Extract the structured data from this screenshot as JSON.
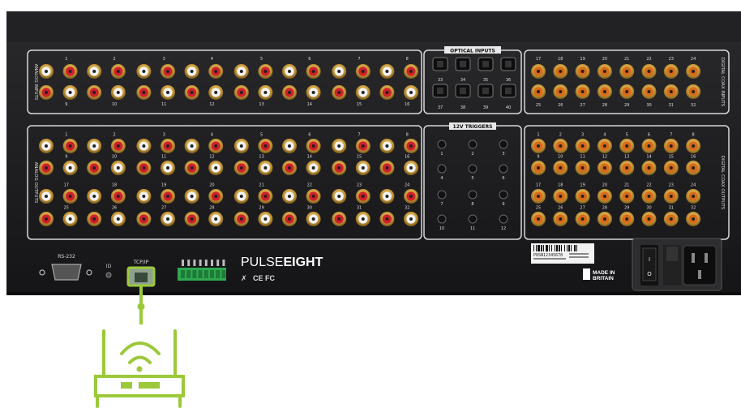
{
  "device": {
    "brand_light": "PULSE",
    "brand_bold": "EIGHT",
    "certification_marks": "CE FC",
    "made_in_line1": "MADE IN",
    "made_in_line2": "BRITAIN",
    "serial_label": "P8SN12345678"
  },
  "ports": {
    "rs232_label": "RS-232",
    "id_label": "ID",
    "tcpip_label": "TCP/IP"
  },
  "sections": {
    "analog_inputs": "ANALOG INPUTS",
    "analog_outputs": "ANALOG OUTPUTS",
    "optical_inputs": "OPTICAL INPUTS",
    "triggers": "12V TRIGGERS",
    "digital_coax_inputs": "DIGITAL COAX INPUTS",
    "digital_coax_outputs": "DIGITAL COAX OUTPUTS"
  },
  "numbers": {
    "analog_in_top": [
      "1",
      "2",
      "3",
      "4",
      "5",
      "6",
      "7",
      "8"
    ],
    "analog_in_bottom": [
      "9",
      "10",
      "11",
      "12",
      "13",
      "14",
      "15",
      "16"
    ],
    "analog_out_r1": [
      "1",
      "2",
      "3",
      "4",
      "5",
      "6",
      "7",
      "8"
    ],
    "analog_out_r2": [
      "9",
      "10",
      "11",
      "12",
      "13",
      "14",
      "15",
      "16"
    ],
    "analog_out_r3": [
      "17",
      "18",
      "19",
      "20",
      "21",
      "22",
      "23",
      "24"
    ],
    "analog_out_r4": [
      "25",
      "26",
      "27",
      "28",
      "29",
      "30",
      "31",
      "32"
    ],
    "optical_top": [
      "33",
      "34",
      "35",
      "36"
    ],
    "optical_bottom": [
      "37",
      "38",
      "39",
      "40"
    ],
    "triggers": [
      "1",
      "2",
      "3",
      "4",
      "5",
      "6",
      "7",
      "8",
      "9",
      "10",
      "11",
      "12"
    ],
    "coax_in_top": [
      "17",
      "18",
      "19",
      "20",
      "21",
      "22",
      "23",
      "24"
    ],
    "coax_in_bottom": [
      "25",
      "26",
      "27",
      "28",
      "29",
      "30",
      "31",
      "32"
    ],
    "coax_out_r1": [
      "1",
      "2",
      "3",
      "4",
      "5",
      "6",
      "7",
      "8"
    ],
    "coax_out_r2": [
      "9",
      "10",
      "11",
      "12",
      "13",
      "14",
      "15",
      "16"
    ],
    "coax_out_r3": [
      "17",
      "18",
      "19",
      "20",
      "21",
      "22",
      "23",
      "24"
    ],
    "coax_out_r4": [
      "25",
      "26",
      "27",
      "28",
      "29",
      "30",
      "31",
      "32"
    ]
  },
  "colors": {
    "chassis": "#1b1b1d",
    "accent_green": "#9cc93b",
    "rca_red": "#d0202a",
    "rca_white": "#f2f2f2",
    "rca_gold": "#c9a24a"
  },
  "icons": {
    "router": "wifi-router-icon",
    "connector": "connection-line"
  }
}
